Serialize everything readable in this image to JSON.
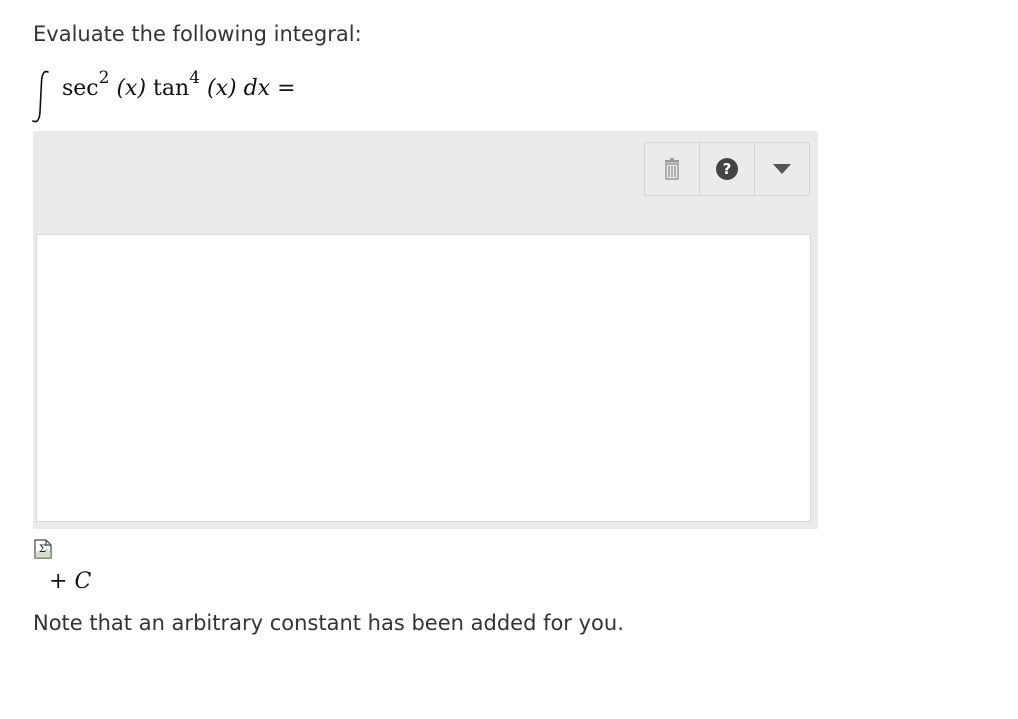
{
  "question": {
    "prompt": "Evaluate the following integral:",
    "formula": {
      "integral_symbol": "∫",
      "sec": "sec",
      "sec_power": "2",
      "arg1": "(x)",
      "tan": "tan",
      "tan_power": "4",
      "arg2": "(x)",
      "differential": "dx",
      "equals": "="
    }
  },
  "editor": {
    "toolbar": {
      "items": [
        {
          "name": "clear",
          "icon": "trash-icon"
        },
        {
          "name": "help",
          "icon": "help-icon"
        },
        {
          "name": "menu",
          "icon": "dropdown-triangle-icon"
        }
      ]
    },
    "answer_value": "",
    "insert_icon": "sigma-equation-icon"
  },
  "constant": {
    "plus": "+",
    "symbol": "C"
  },
  "note": "Note that an arbitrary constant has been added for you.",
  "colors": {
    "editor_bg": "#ebebeb",
    "text": "#333333",
    "help_icon_bg": "#444444"
  }
}
